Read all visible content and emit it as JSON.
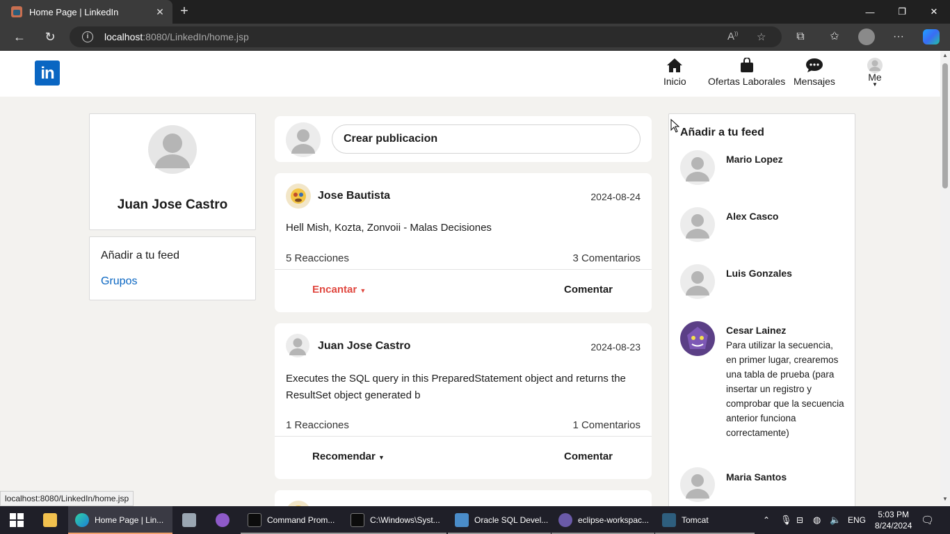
{
  "browser": {
    "tab_title": "Home Page | LinkedIn",
    "url_host": "localhost",
    "url_rest": ":8080/LinkedIn/home.jsp",
    "status_url": "localhost:8080/LinkedIn/home.jsp"
  },
  "brand": {
    "logo_text": "in",
    "color": "#0a66c2"
  },
  "nav": {
    "inicio": "Inicio",
    "ofertas": "Ofertas Laborales",
    "mensajes": "Mensajes",
    "me": "Me"
  },
  "profile": {
    "name": "Juan Jose Castro",
    "feed_title": "Añadir a tu feed",
    "groups_link": "Grupos"
  },
  "composer": {
    "placeholder": "Crear publicacion"
  },
  "posts": [
    {
      "author": "Jose Bautista",
      "date": "2024-08-24",
      "text": "Hell Mish, Kozta, Zonvoii - Malas Decisiones",
      "reactions": "5 Reacciones",
      "comments": "3 Comentarios",
      "reaction_button": "Encantar",
      "comment_button": "Comentar"
    },
    {
      "author": "Juan Jose Castro",
      "date": "2024-08-23",
      "text": "Executes the SQL query in this PreparedStatement object and returns the ResultSet object generated b",
      "reactions": "1 Reacciones",
      "comments": "1 Comentarios",
      "reaction_button": "Recomendar",
      "comment_button": "Comentar"
    }
  ],
  "suggestions": {
    "title": "Añadir a tu feed",
    "people": [
      {
        "name": "Mario Lopez"
      },
      {
        "name": "Alex Casco"
      },
      {
        "name": "Luis Gonzales"
      },
      {
        "name": "Cesar Lainez",
        "text": "Para utilizar la secuencia, en primer lugar, crearemos una tabla de prueba (para insertar un registro y comprobar que la secuencia anterior funciona correctamente)"
      },
      {
        "name": "Maria Santos"
      }
    ]
  },
  "taskbar": {
    "items": [
      "Home Page | Lin...",
      "Command Prom...",
      "C:\\Windows\\Syst...",
      "Oracle SQL Devel...",
      "eclipse-workspac...",
      "Tomcat"
    ],
    "language": "ENG",
    "time": "5:03 PM",
    "date": "8/24/2024"
  }
}
